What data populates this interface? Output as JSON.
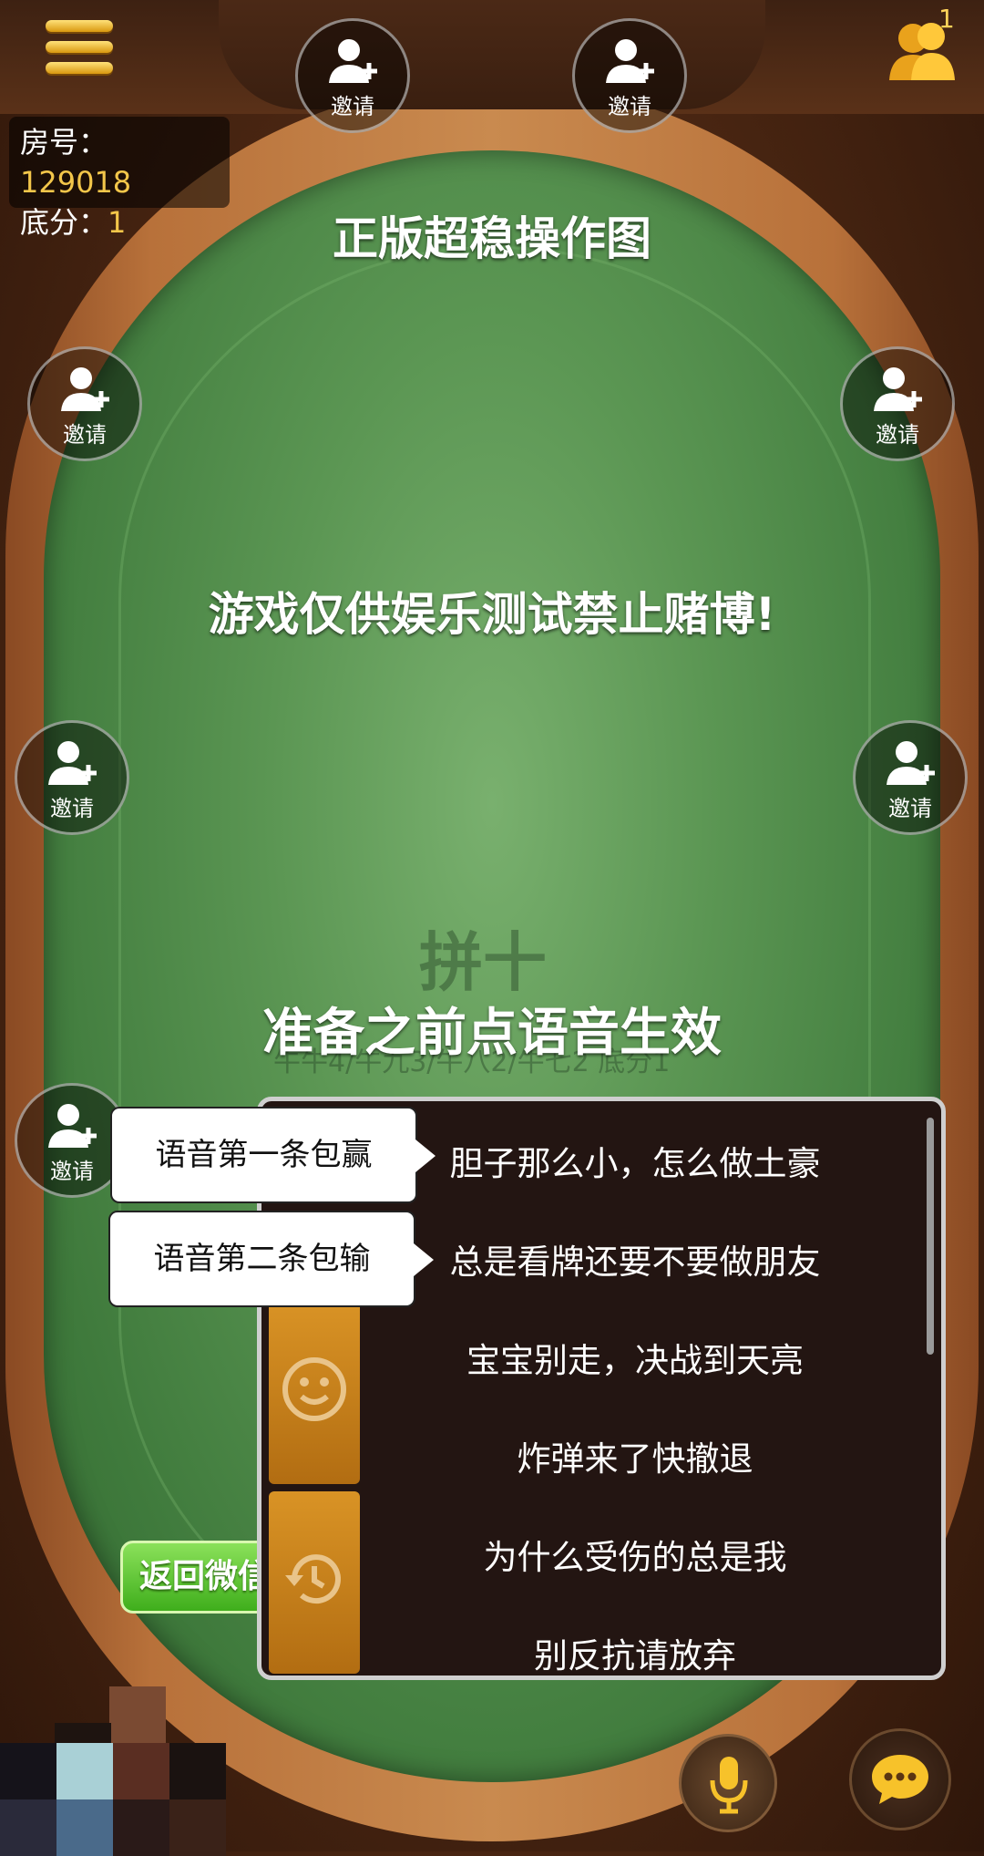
{
  "room": {
    "room_label": "房号：",
    "room_number": "129018",
    "score_label": "底分：",
    "score_value": "1"
  },
  "player_count": "1",
  "invite_label": "邀请",
  "overlay": {
    "title": "正版超稳操作图",
    "warning": "游戏仅供娱乐测试禁止赌博!",
    "voice_tip": "准备之前点语音生效"
  },
  "table_watermark": {
    "game_name": "拼十",
    "rules": "牛牛4/牛九3/牛八2/牛七2 底分1"
  },
  "callouts": {
    "first": "语音第一条包赢",
    "second": "语音第二条包输"
  },
  "voice_phrases": [
    "胆子那么小，怎么做土豪",
    "总是看牌还要不要做朋友",
    "宝宝别走，决战到天亮",
    "炸弹来了快撤退",
    "为什么受伤的总是我",
    "别反抗请放弃"
  ],
  "return_button": "返回微信",
  "colors": {
    "accent": "#f3c64a",
    "felt": "#5b9653",
    "panel": "#231512",
    "button_green": "#3fae1c"
  }
}
